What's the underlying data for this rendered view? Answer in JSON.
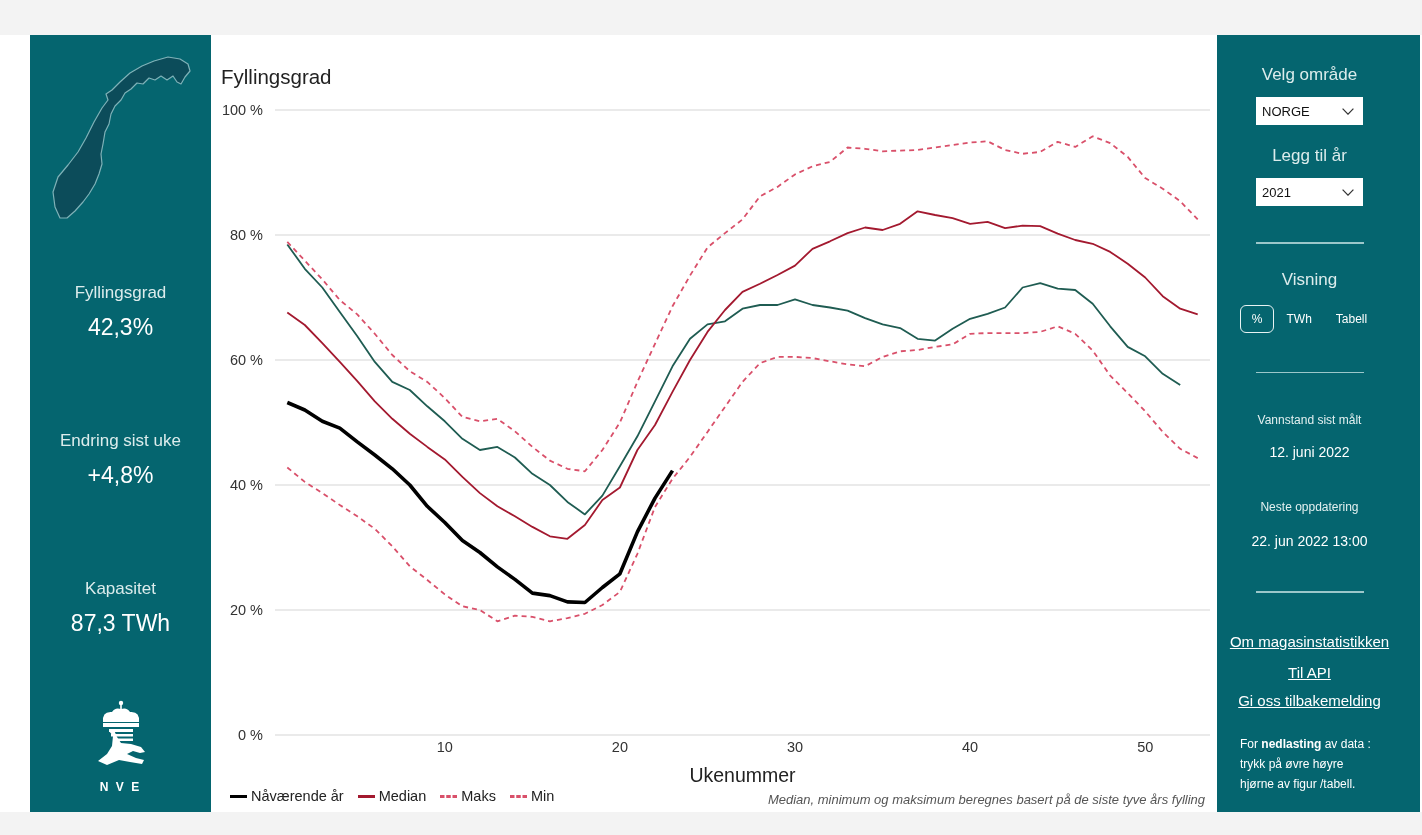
{
  "left_panel": {
    "stats": [
      {
        "label": "Fyllingsgrad",
        "value": "42,3%"
      },
      {
        "label": "Endring sist uke",
        "value": "+4,8%"
      },
      {
        "label": "Kapasitet",
        "value": "87,3 TWh"
      }
    ],
    "logo_text": "N V E"
  },
  "chart": {
    "chart_data": {
      "type": "line",
      "title": "Fyllingsgrad",
      "xlabel": "Ukenummer",
      "x": [
        1,
        2,
        3,
        4,
        5,
        6,
        7,
        8,
        9,
        10,
        11,
        12,
        13,
        14,
        15,
        16,
        17,
        18,
        19,
        20,
        21,
        22,
        23,
        24,
        25,
        26,
        27,
        28,
        29,
        30,
        31,
        32,
        33,
        34,
        35,
        36,
        37,
        38,
        39,
        40,
        41,
        42,
        43,
        44,
        45,
        46,
        47,
        48,
        49,
        50,
        51,
        52,
        53
      ],
      "xlim": [
        0.3,
        53.7
      ],
      "ylim": [
        0,
        100
      ],
      "xticks": [
        10,
        20,
        30,
        40,
        50
      ],
      "yticks": [
        {
          "value": 0,
          "label": "0 %"
        },
        {
          "value": 20,
          "label": "20 %"
        },
        {
          "value": 40,
          "label": "40 %"
        },
        {
          "value": 60,
          "label": "60 %"
        },
        {
          "value": 80,
          "label": "80 %"
        },
        {
          "value": 100,
          "label": "100 %"
        }
      ],
      "grid": true,
      "legend": "bottom",
      "series": [
        {
          "name": "Nåværende år",
          "color": "#000000",
          "line_style": "solid",
          "values": [
            53.2,
            52.0,
            50.2,
            49.1,
            46.9,
            44.8,
            42.6,
            40.0,
            36.6,
            34.0,
            31.1,
            29.2,
            26.9,
            24.9,
            22.7,
            22.3,
            21.3,
            21.2,
            23.6,
            25.8,
            32.5,
            37.9,
            42.3,
            null,
            null,
            null,
            null,
            null,
            null,
            null,
            null,
            null,
            null,
            null,
            null,
            null,
            null,
            null,
            null,
            null,
            null,
            null,
            null,
            null,
            null,
            null,
            null,
            null,
            null,
            null,
            null,
            null,
            null
          ]
        },
        {
          "name": "Median",
          "color": "#a3192f",
          "line_style": "solid",
          "values": [
            67.6,
            65.6,
            62.7,
            59.7,
            56.6,
            53.4,
            50.6,
            48.2,
            46.1,
            44.1,
            41.3,
            38.7,
            36.6,
            35.0,
            33.3,
            31.8,
            31.4,
            33.6,
            37.6,
            39.6,
            45.6,
            49.6,
            54.9,
            60.0,
            64.5,
            68.0,
            70.9,
            72.2,
            73.6,
            75.1,
            77.8,
            79.0,
            80.3,
            81.2,
            80.8,
            81.8,
            83.8,
            83.2,
            82.7,
            81.8,
            82.1,
            81.1,
            81.5,
            81.4,
            80.2,
            79.2,
            78.6,
            77.3,
            75.4,
            73.2,
            70.2,
            68.2,
            67.3
          ]
        },
        {
          "name": "Maks",
          "color": "#d9506a",
          "line_style": "dashed",
          "values": [
            78.9,
            75.9,
            72.9,
            69.6,
            67.3,
            64.2,
            60.8,
            58.2,
            56.5,
            53.9,
            50.9,
            50.2,
            50.6,
            48.6,
            46.1,
            43.9,
            42.6,
            42.2,
            45.6,
            50.0,
            56.5,
            62.6,
            68.6,
            73.5,
            78.0,
            80.3,
            82.5,
            86.2,
            87.7,
            89.7,
            91.0,
            91.7,
            94.0,
            93.8,
            93.4,
            93.5,
            93.6,
            94.0,
            94.4,
            94.8,
            95.0,
            93.6,
            93.0,
            93.3,
            94.9,
            94.1,
            95.8,
            94.7,
            92.5,
            89.1,
            87.4,
            85.4,
            82.5
          ]
        },
        {
          "name": "Min",
          "color": "#d9506a",
          "line_style": "dashed",
          "values": [
            42.8,
            40.5,
            38.7,
            36.8,
            35.0,
            33.0,
            30.2,
            27.0,
            24.8,
            22.5,
            20.6,
            20.0,
            18.2,
            19.1,
            18.9,
            18.2,
            18.7,
            19.4,
            20.8,
            22.9,
            29.0,
            36.5,
            41.0,
            44.5,
            48.5,
            52.5,
            56.5,
            59.5,
            60.5,
            60.5,
            60.3,
            59.8,
            59.3,
            59.0,
            60.5,
            61.4,
            61.6,
            62.1,
            62.5,
            64.2,
            64.3,
            64.3,
            64.3,
            64.5,
            65.4,
            64.2,
            61.5,
            57.5,
            54.7,
            51.8,
            48.5,
            45.8,
            44.3
          ]
        },
        {
          "color": "#1f5c52",
          "line_style": "solid",
          "values": [
            78.5,
            74.6,
            71.6,
            67.7,
            63.8,
            59.7,
            56.5,
            55.2,
            52.6,
            50.2,
            47.4,
            45.6,
            46.1,
            44.4,
            41.8,
            40.0,
            37.3,
            35.3,
            38.3,
            43.0,
            47.8,
            53.4,
            59.0,
            63.4,
            65.7,
            66.2,
            68.2,
            68.8,
            68.8,
            69.7,
            68.8,
            68.4,
            67.9,
            66.7,
            65.7,
            65.1,
            63.4,
            63.1,
            65.0,
            66.6,
            67.4,
            68.4,
            71.6,
            72.3,
            71.4,
            71.2,
            69.0,
            65.4,
            62.1,
            60.6,
            57.8,
            56.0,
            null
          ]
        }
      ]
    },
    "footnote": "Median, minimum og maksimum beregnes basert på de siste tyve års fylling"
  },
  "right_panel": {
    "area_select": {
      "label": "Velg område",
      "value": "NORGE"
    },
    "year_select": {
      "label": "Legg til år",
      "value": "2021"
    },
    "view": {
      "label": "Visning",
      "options": [
        {
          "label": "%",
          "selected": true
        },
        {
          "label": "TWh",
          "selected": false
        },
        {
          "label": "Tabell",
          "selected": false
        }
      ]
    },
    "info": [
      {
        "label": "Vannstand sist målt",
        "value": "12. juni 2022"
      },
      {
        "label": "Neste oppdatering",
        "value": "22. jun 2022 13:00"
      }
    ],
    "links": [
      "Om magasinstatistikken",
      "Til API",
      "Gi oss tilbakemelding"
    ],
    "note": "For **nedlasting** av data : trykk på øvre høyre hjørne av figur /tabell."
  }
}
